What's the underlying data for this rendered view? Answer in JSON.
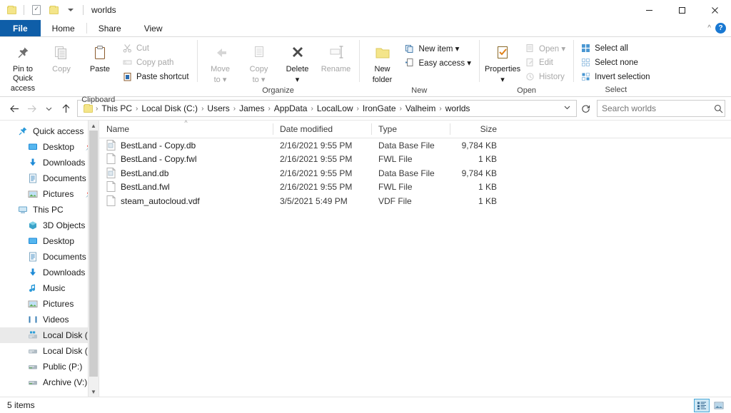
{
  "window": {
    "title": "worlds",
    "quick_access": [
      {
        "name": "folder-icon",
        "label": "Folder"
      },
      {
        "name": "properties-icon",
        "label": "Properties"
      },
      {
        "name": "new-folder-icon",
        "label": "New folder"
      },
      {
        "name": "chevron-down-icon",
        "label": "Customize Quick Access Toolbar"
      }
    ],
    "controls": {
      "minimize": "—",
      "maximize": "☐",
      "close": "✕"
    }
  },
  "ribbon": {
    "tabs": [
      {
        "label": "File",
        "id": "file",
        "active": false
      },
      {
        "label": "Home",
        "id": "home",
        "active": true
      },
      {
        "label": "Share",
        "id": "share",
        "active": false
      },
      {
        "label": "View",
        "id": "view",
        "active": false
      }
    ],
    "collapse_icon": "chevron-up-icon",
    "help_label": "?",
    "groups": [
      {
        "label": "Clipboard",
        "big_buttons": [
          {
            "label": "Pin to Quick\naccess",
            "line1": "Pin to Quick",
            "line2": "access",
            "icon": "pin-icon",
            "disabled": false
          },
          {
            "label": "Copy",
            "line1": "Copy",
            "line2": "",
            "icon": "copy-icon",
            "disabled": true
          },
          {
            "label": "Paste",
            "line1": "Paste",
            "line2": "",
            "icon": "paste-icon",
            "disabled": false
          }
        ],
        "small_buttons": [
          {
            "label": "Cut",
            "icon": "scissors-icon",
            "disabled": true
          },
          {
            "label": "Copy path",
            "icon": "copy-path-icon",
            "disabled": true
          },
          {
            "label": "Paste shortcut",
            "icon": "paste-shortcut-icon",
            "disabled": false
          }
        ]
      },
      {
        "label": "Organize",
        "big_buttons": [
          {
            "label": "Move to",
            "line1": "Move",
            "line2": "to ▾",
            "icon": "move-to-icon",
            "disabled": true
          },
          {
            "label": "Copy to",
            "line1": "Copy",
            "line2": "to ▾",
            "icon": "copy-to-icon",
            "disabled": true
          },
          {
            "label": "Delete",
            "line1": "Delete",
            "line2": "▾",
            "icon": "delete-x-icon",
            "disabled": false
          },
          {
            "label": "Rename",
            "line1": "Rename",
            "line2": "",
            "icon": "rename-icon",
            "disabled": true
          }
        ],
        "small_buttons": []
      },
      {
        "label": "New",
        "big_buttons": [
          {
            "label": "New folder",
            "line1": "New",
            "line2": "folder",
            "icon": "new-folder-icon",
            "disabled": false
          }
        ],
        "small_buttons": [
          {
            "label": "New item ▾",
            "icon": "new-item-icon",
            "disabled": false
          },
          {
            "label": "Easy access ▾",
            "icon": "easy-access-icon",
            "disabled": false
          }
        ]
      },
      {
        "label": "Open",
        "big_buttons": [
          {
            "label": "Properties",
            "line1": "Properties",
            "line2": "▾",
            "icon": "properties-icon",
            "disabled": false
          }
        ],
        "small_buttons": [
          {
            "label": "Open ▾",
            "icon": "open-icon",
            "disabled": true
          },
          {
            "label": "Edit",
            "icon": "edit-icon",
            "disabled": true
          },
          {
            "label": "History",
            "icon": "history-icon",
            "disabled": true
          }
        ]
      },
      {
        "label": "Select",
        "big_buttons": [],
        "small_buttons": [
          {
            "label": "Select all",
            "icon": "select-all-icon",
            "disabled": false
          },
          {
            "label": "Select none",
            "icon": "select-none-icon",
            "disabled": false
          },
          {
            "label": "Invert selection",
            "icon": "invert-selection-icon",
            "disabled": false
          }
        ]
      }
    ]
  },
  "addressbar": {
    "back_icon": "arrow-left-icon",
    "forward_icon": "arrow-right-icon",
    "recent_icon": "chevron-down-icon",
    "up_icon": "arrow-up-icon",
    "breadcrumbs": [
      "This PC",
      "Local Disk (C:)",
      "Users",
      "James",
      "AppData",
      "LocalLow",
      "IronGate",
      "Valheim",
      "worlds"
    ],
    "separator": "›",
    "dropdown_icon": "chevron-down-icon",
    "refresh_icon": "refresh-icon",
    "search": {
      "placeholder": "Search worlds",
      "value": "",
      "icon": "search-icon"
    }
  },
  "sidebar": {
    "items": [
      {
        "label": "Quick access",
        "icon": "star-pin-icon",
        "indent": 0,
        "pinned": false,
        "selected": false
      },
      {
        "label": "Desktop",
        "icon": "desktop-icon",
        "indent": 1,
        "pinned": true,
        "selected": false
      },
      {
        "label": "Downloads",
        "icon": "downloads-icon",
        "indent": 1,
        "pinned": true,
        "selected": false
      },
      {
        "label": "Documents",
        "icon": "documents-icon",
        "indent": 1,
        "pinned": true,
        "selected": false
      },
      {
        "label": "Pictures",
        "icon": "pictures-icon",
        "indent": 1,
        "pinned": true,
        "selected": false
      },
      {
        "label": "This PC",
        "icon": "this-pc-icon",
        "indent": 0,
        "pinned": false,
        "selected": false
      },
      {
        "label": "3D Objects",
        "icon": "3d-objects-icon",
        "indent": 1,
        "pinned": false,
        "selected": false
      },
      {
        "label": "Desktop",
        "icon": "desktop-icon",
        "indent": 1,
        "pinned": false,
        "selected": false
      },
      {
        "label": "Documents",
        "icon": "documents-icon",
        "indent": 1,
        "pinned": false,
        "selected": false
      },
      {
        "label": "Downloads",
        "icon": "downloads-icon",
        "indent": 1,
        "pinned": false,
        "selected": false
      },
      {
        "label": "Music",
        "icon": "music-icon",
        "indent": 1,
        "pinned": false,
        "selected": false
      },
      {
        "label": "Pictures",
        "icon": "pictures-icon",
        "indent": 1,
        "pinned": false,
        "selected": false
      },
      {
        "label": "Videos",
        "icon": "videos-icon",
        "indent": 1,
        "pinned": false,
        "selected": false
      },
      {
        "label": "Local Disk (C:)",
        "icon": "windows-drive-icon",
        "indent": 1,
        "pinned": false,
        "selected": true
      },
      {
        "label": "Local Disk (D:)",
        "icon": "drive-icon",
        "indent": 1,
        "pinned": false,
        "selected": false
      },
      {
        "label": "Public (P:)",
        "icon": "network-drive-icon",
        "indent": 1,
        "pinned": false,
        "selected": false
      },
      {
        "label": "Archive (V:)",
        "icon": "network-drive-icon",
        "indent": 1,
        "pinned": false,
        "selected": false
      }
    ],
    "scroll_up_icon": "chevron-up-icon",
    "scroll_down_icon": "chevron-down-icon"
  },
  "filelist": {
    "columns": [
      {
        "label": "Name",
        "key": "name",
        "sorted": "asc"
      },
      {
        "label": "Date modified",
        "key": "date",
        "sorted": ""
      },
      {
        "label": "Type",
        "key": "type",
        "sorted": ""
      },
      {
        "label": "Size",
        "key": "size",
        "sorted": ""
      }
    ],
    "sort_icon": "chevron-up-icon",
    "rows": [
      {
        "name": "BestLand - Copy.db",
        "date": "2/16/2021 9:55 PM",
        "type": "Data Base File",
        "size": "9,784 KB",
        "icon": "db-file-icon"
      },
      {
        "name": "BestLand - Copy.fwl",
        "date": "2/16/2021 9:55 PM",
        "type": "FWL File",
        "size": "1 KB",
        "icon": "generic-file-icon"
      },
      {
        "name": "BestLand.db",
        "date": "2/16/2021 9:55 PM",
        "type": "Data Base File",
        "size": "9,784 KB",
        "icon": "db-file-icon"
      },
      {
        "name": "BestLand.fwl",
        "date": "2/16/2021 9:55 PM",
        "type": "FWL File",
        "size": "1 KB",
        "icon": "generic-file-icon"
      },
      {
        "name": "steam_autocloud.vdf",
        "date": "3/5/2021 5:49 PM",
        "type": "VDF File",
        "size": "1 KB",
        "icon": "generic-file-icon"
      }
    ]
  },
  "statusbar": {
    "item_count": "5 items",
    "views": [
      {
        "name": "details-view-button",
        "icon": "details-view-icon",
        "active": true
      },
      {
        "name": "large-icons-view-button",
        "icon": "large-icons-view-icon",
        "active": false
      }
    ]
  },
  "colors": {
    "file_tab_blue": "#0f5ea8",
    "selection_blue": "#cfe8f5",
    "folder_yellow": "#f4e58a",
    "accent_blue": "#1978d2"
  }
}
